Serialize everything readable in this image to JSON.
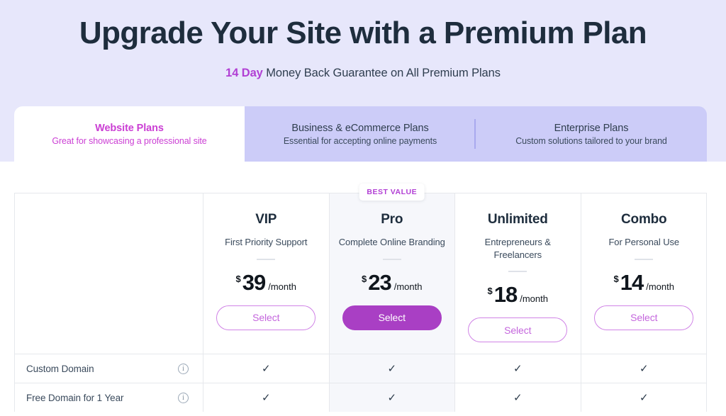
{
  "hero": {
    "title": "Upgrade Your Site with a Premium Plan",
    "subtitle_accent": "14 Day",
    "subtitle_rest": " Money Back Guarantee on All Premium Plans",
    "background_color": "#e7e7fb",
    "accent_color": "#b13fd4"
  },
  "tabs": [
    {
      "title": "Website Plans",
      "description": "Great for showcasing a professional site",
      "active": true
    },
    {
      "title": "Business & eCommerce Plans",
      "description": "Essential for accepting online payments",
      "active": false
    },
    {
      "title": "Enterprise Plans",
      "description": "Custom solutions tailored to your brand",
      "active": false
    }
  ],
  "table": {
    "badge_label": "BEST VALUE",
    "plans": [
      {
        "name": "VIP",
        "description": "First Priority Support",
        "currency": "$",
        "price": "39",
        "period": "/month",
        "button_label": "Select",
        "highlighted": false,
        "best_value": false
      },
      {
        "name": "Pro",
        "description": "Complete Online Branding",
        "currency": "$",
        "price": "23",
        "period": "/month",
        "button_label": "Select",
        "highlighted": true,
        "best_value": true
      },
      {
        "name": "Unlimited",
        "description": "Entrepreneurs & Freelancers",
        "currency": "$",
        "price": "18",
        "period": "/month",
        "button_label": "Select",
        "highlighted": false,
        "best_value": false
      },
      {
        "name": "Combo",
        "description": "For Personal Use",
        "currency": "$",
        "price": "14",
        "period": "/month",
        "button_label": "Select",
        "highlighted": false,
        "best_value": false
      }
    ],
    "features": [
      {
        "name": "Custom Domain",
        "info": "i",
        "values": [
          "check",
          "check",
          "check",
          "check"
        ]
      },
      {
        "name": "Free Domain for 1 Year",
        "info": "i",
        "values": [
          "check",
          "check",
          "check",
          "check"
        ]
      }
    ],
    "check_glyph": "✓"
  }
}
